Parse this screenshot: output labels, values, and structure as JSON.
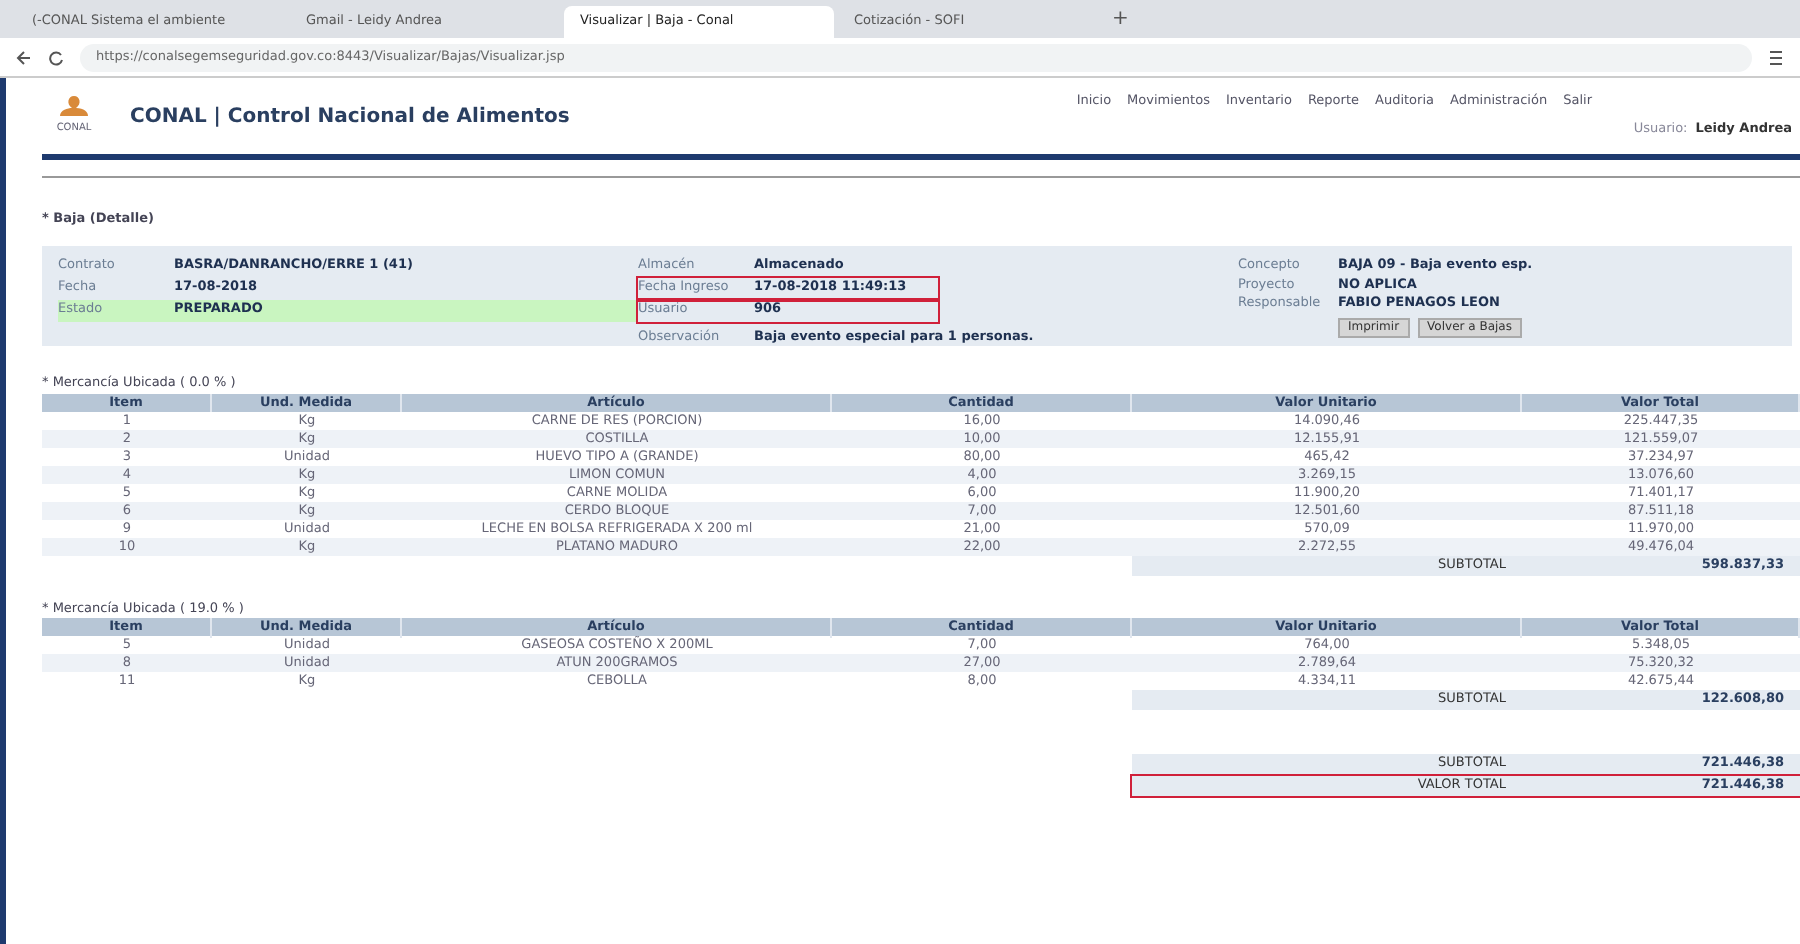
{
  "browser": {
    "tabs": [
      {
        "label": "(-CONAL Sistema el ambiente",
        "selected": false
      },
      {
        "label": "Gmail - Leidy Andrea",
        "selected": false
      },
      {
        "label": "Visualizar | Baja - Conal",
        "selected": true
      },
      {
        "label": "Cotización - SOFI",
        "selected": false
      }
    ],
    "new_tab": "+",
    "url": "https://conalsegemseguridad.gov.co:8443/Visualizar/Bajas/Visualizar.jsp"
  },
  "header": {
    "title": "CONAL | Control Nacional de Alimentos",
    "logo_text": "CONAL",
    "nav": [
      "Inicio",
      "Movimientos",
      "Inventario",
      "Reporte",
      "Auditoria",
      "Administración",
      "Salir"
    ],
    "user_label": "Usuario:",
    "user": "Leidy Andrea"
  },
  "page_title": "* Baja (Detalle)",
  "details": {
    "left": [
      {
        "label": "Contrato",
        "value": "BASRA/DANRANCHO/ERRE 1 (41)",
        "highlighted": false
      },
      {
        "label": "Fecha",
        "value": "17-08-2018",
        "highlighted": false
      },
      {
        "label": "Estado",
        "value": "PREPARADO",
        "highlighted": false
      }
    ],
    "middle": [
      {
        "label": "Almacén",
        "value": "Almacenado",
        "highlighted": false
      },
      {
        "label": "Fecha Ingreso",
        "value": "17-08-2018 11:49:13",
        "highlighted": true
      },
      {
        "label": "Usuario",
        "value": "906",
        "highlighted": true
      },
      {
        "label": "Observación",
        "value": "Baja evento especial para 1 personas.",
        "highlighted": false
      }
    ],
    "right": [
      {
        "label": "Concepto",
        "value": "BAJA 09 - Baja evento esp."
      },
      {
        "label": "Proyecto",
        "value": "NO APLICA"
      },
      {
        "label": "Responsable",
        "value": "FABIO PENAGOS LEON"
      }
    ],
    "buttons": [
      "Imprimir",
      "Volver a Bajas"
    ]
  },
  "sections": [
    {
      "title": "* Mercancía Ubicada ( 0.0 % )",
      "columns": [
        "Item",
        "Und. Medida",
        "Artículo",
        "Cantidad",
        "Valor Unitario",
        "Valor Total"
      ],
      "rows": [
        [
          "1",
          "Kg",
          "CARNE DE RES (PORCION)",
          "16,00",
          "14.090,46",
          "225.447,35"
        ],
        [
          "2",
          "Kg",
          "COSTILLA",
          "10,00",
          "12.155,91",
          "121.559,07"
        ],
        [
          "3",
          "Unidad",
          "HUEVO TIPO A (GRANDE)",
          "80,00",
          "465,42",
          "37.234,97"
        ],
        [
          "4",
          "Kg",
          "LIMON COMUN",
          "4,00",
          "3.269,15",
          "13.076,60"
        ],
        [
          "5",
          "Kg",
          "CARNE MOLIDA",
          "6,00",
          "11.900,20",
          "71.401,17"
        ],
        [
          "6",
          "Kg",
          "CERDO BLOQUE",
          "7,00",
          "12.501,60",
          "87.511,18"
        ],
        [
          "9",
          "Unidad",
          "LECHE EN BOLSA REFRIGERADA X 200 ml",
          "21,00",
          "570,09",
          "11.970,00"
        ],
        [
          "10",
          "Kg",
          "PLATANO MADURO",
          "22,00",
          "2.272,55",
          "49.476,04"
        ]
      ],
      "subtotal_label": "SUBTOTAL",
      "subtotal": "598.837,33"
    },
    {
      "title": "* Mercancía Ubicada ( 19.0 % )",
      "columns": [
        "Item",
        "Und. Medida",
        "Artículo",
        "Cantidad",
        "Valor Unitario",
        "Valor Total"
      ],
      "rows": [
        [
          "5",
          "Unidad",
          "GASEOSA COSTEÑO X 200ML",
          "7,00",
          "764,00",
          "5.348,05"
        ],
        [
          "8",
          "Unidad",
          "ATUN 200GRAMOS",
          "27,00",
          "2.789,64",
          "75.320,32"
        ],
        [
          "11",
          "Kg",
          "CEBOLLA",
          "8,00",
          "4.334,11",
          "42.675,44"
        ]
      ],
      "subtotal_label": "SUBTOTAL",
      "subtotal": "122.608,80"
    }
  ],
  "totals": [
    {
      "label": "SUBTOTAL",
      "value": "721.446,38",
      "highlighted": false
    },
    {
      "label": "VALOR TOTAL",
      "value": "721.446,38",
      "highlighted": true
    }
  ]
}
